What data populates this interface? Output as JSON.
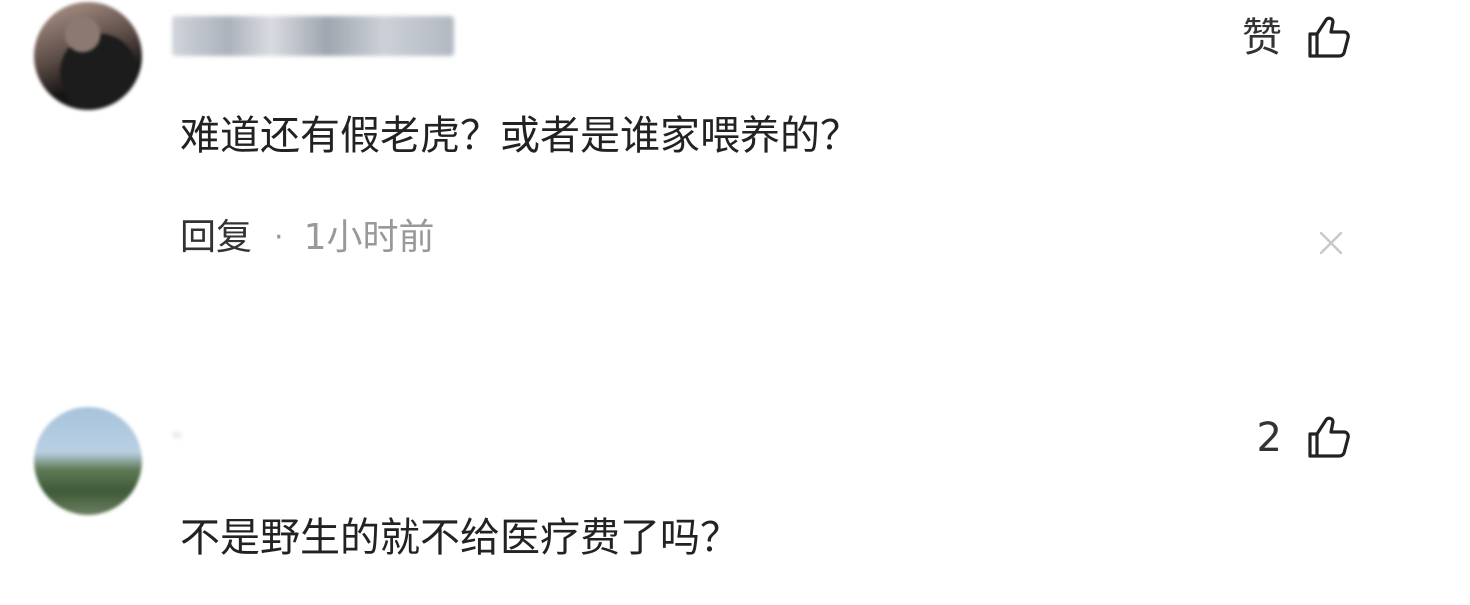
{
  "comments": [
    {
      "like_label": "赞",
      "text": "难道还有假老虎？或者是谁家喂养的？",
      "reply_label": "回复",
      "separator": "·",
      "time": "1小时前"
    },
    {
      "like_label": "2",
      "text": "不是野生的就不给医疗费了吗？"
    }
  ],
  "icons": {
    "like": "thumb-up-icon",
    "dismiss": "close-icon"
  },
  "colors": {
    "text": "#222222",
    "muted": "#999999",
    "background": "#ffffff"
  }
}
